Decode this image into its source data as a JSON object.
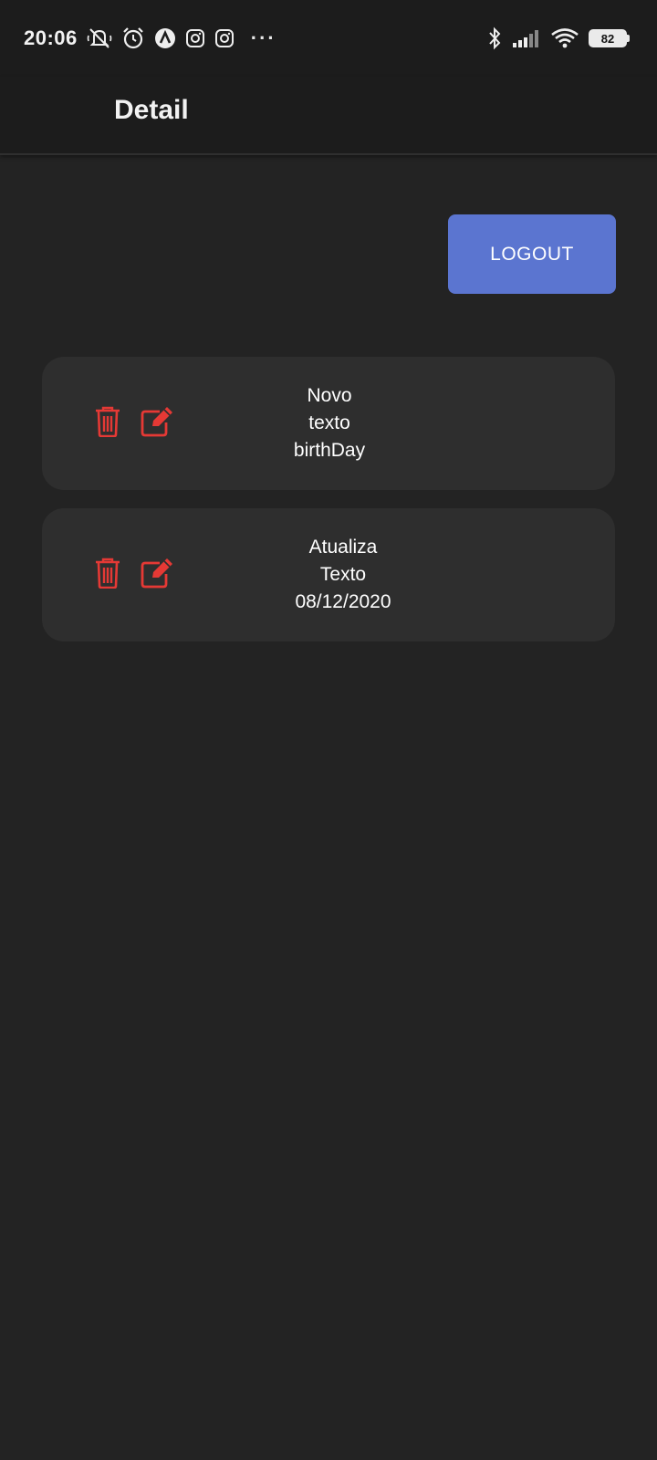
{
  "status_bar": {
    "time": "20:06",
    "more": "···",
    "battery": "82",
    "icons": [
      "muted-bell-icon",
      "alarm-icon",
      "app-a-icon",
      "instagram-icon",
      "instagram-icon",
      "bluetooth-icon",
      "signal-icon",
      "wifi-icon",
      "battery-icon"
    ]
  },
  "app_bar": {
    "title": "Detail"
  },
  "logout_button": {
    "label": "LOGOUT",
    "color": "#5b75d0"
  },
  "cards": [
    {
      "title": "Novo",
      "text": "texto",
      "date": "birthDay"
    },
    {
      "title": "Atualiza",
      "text": "Texto",
      "date": "08/12/2020"
    }
  ],
  "colors": {
    "accent_red": "#e53935",
    "background": "#232323",
    "card": "#2e2e2e"
  }
}
